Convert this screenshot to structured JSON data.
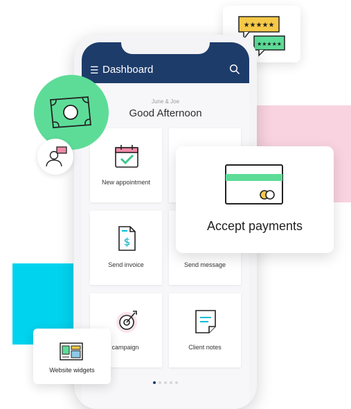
{
  "app": {
    "title": "Dashboard",
    "menu_icon": "hamburger-menu-icon",
    "search_icon": "search-icon"
  },
  "greeting": {
    "names": "June & Joe",
    "message": "Good Afternoon"
  },
  "tiles": [
    {
      "label": "New appointment",
      "icon": "calendar-check-icon"
    },
    {
      "label": "",
      "icon": ""
    },
    {
      "label": "Send invoice",
      "icon": "invoice-dollar-icon"
    },
    {
      "label": "Send message",
      "icon": ""
    },
    {
      "label": "te campaign",
      "icon": "target-campaign-icon"
    },
    {
      "label": "Client notes",
      "icon": "notes-icon"
    }
  ],
  "pagination": {
    "total": 5,
    "active": 1
  },
  "cards": {
    "payments": {
      "label": "Accept payments",
      "icon": "credit-card-icon"
    },
    "widgets": {
      "label": "Website widgets",
      "icon": "website-widget-icon"
    },
    "reviews": {
      "icon": "star-reviews-icon"
    },
    "money": {
      "icon": "money-bill-icon"
    },
    "client": {
      "icon": "client-message-icon"
    }
  },
  "colors": {
    "navy": "#1e3c6a",
    "green": "#5ddc98",
    "pink": "#f9d3df",
    "cyan": "#00d3ee",
    "yellow": "#f7c948"
  }
}
